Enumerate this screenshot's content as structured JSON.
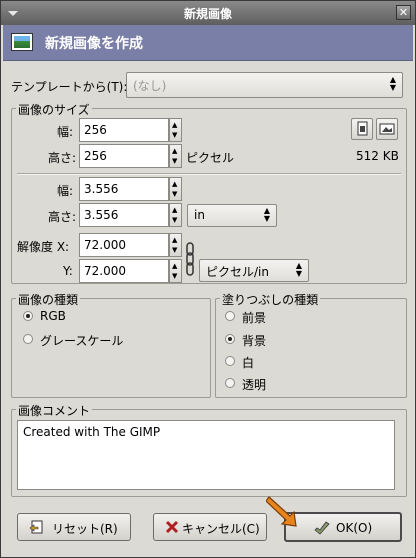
{
  "window": {
    "title": "新規画像"
  },
  "banner": {
    "heading": "新規画像を作成"
  },
  "template": {
    "label": "テンプレートから(T):",
    "value": "(なし)"
  },
  "size_frame": {
    "legend": "画像のサイズ",
    "width_label": "幅:",
    "width_value": "256",
    "height_label": "高さ:",
    "height_value": "256",
    "pixel_unit": "ピクセル",
    "file_size": "512 KB"
  },
  "print_size": {
    "width_label": "幅:",
    "width_value": "3.556",
    "height_label": "高さ:",
    "height_value": "3.556",
    "unit": "in",
    "res_x_label": "解像度 X:",
    "res_x_value": "72.000",
    "res_y_label": "Y:",
    "res_y_value": "72.000",
    "res_unit": "ピクセル/in"
  },
  "image_type": {
    "legend": "画像の種類",
    "options": [
      "RGB",
      "グレースケール"
    ],
    "selected": "RGB"
  },
  "fill_type": {
    "legend": "塗りつぶしの種類",
    "options": [
      "前景",
      "背景",
      "白",
      "透明"
    ],
    "selected": "背景"
  },
  "comment": {
    "legend": "画像コメント",
    "value": "Created with The GIMP"
  },
  "buttons": {
    "reset": "リセット(R)",
    "cancel": "キャンセル(C)",
    "ok": "OK(O)"
  },
  "colors": {
    "banner": "#7a7fa8",
    "titlebar": "#6e6e6e",
    "window_bg": "#dcdad5"
  }
}
